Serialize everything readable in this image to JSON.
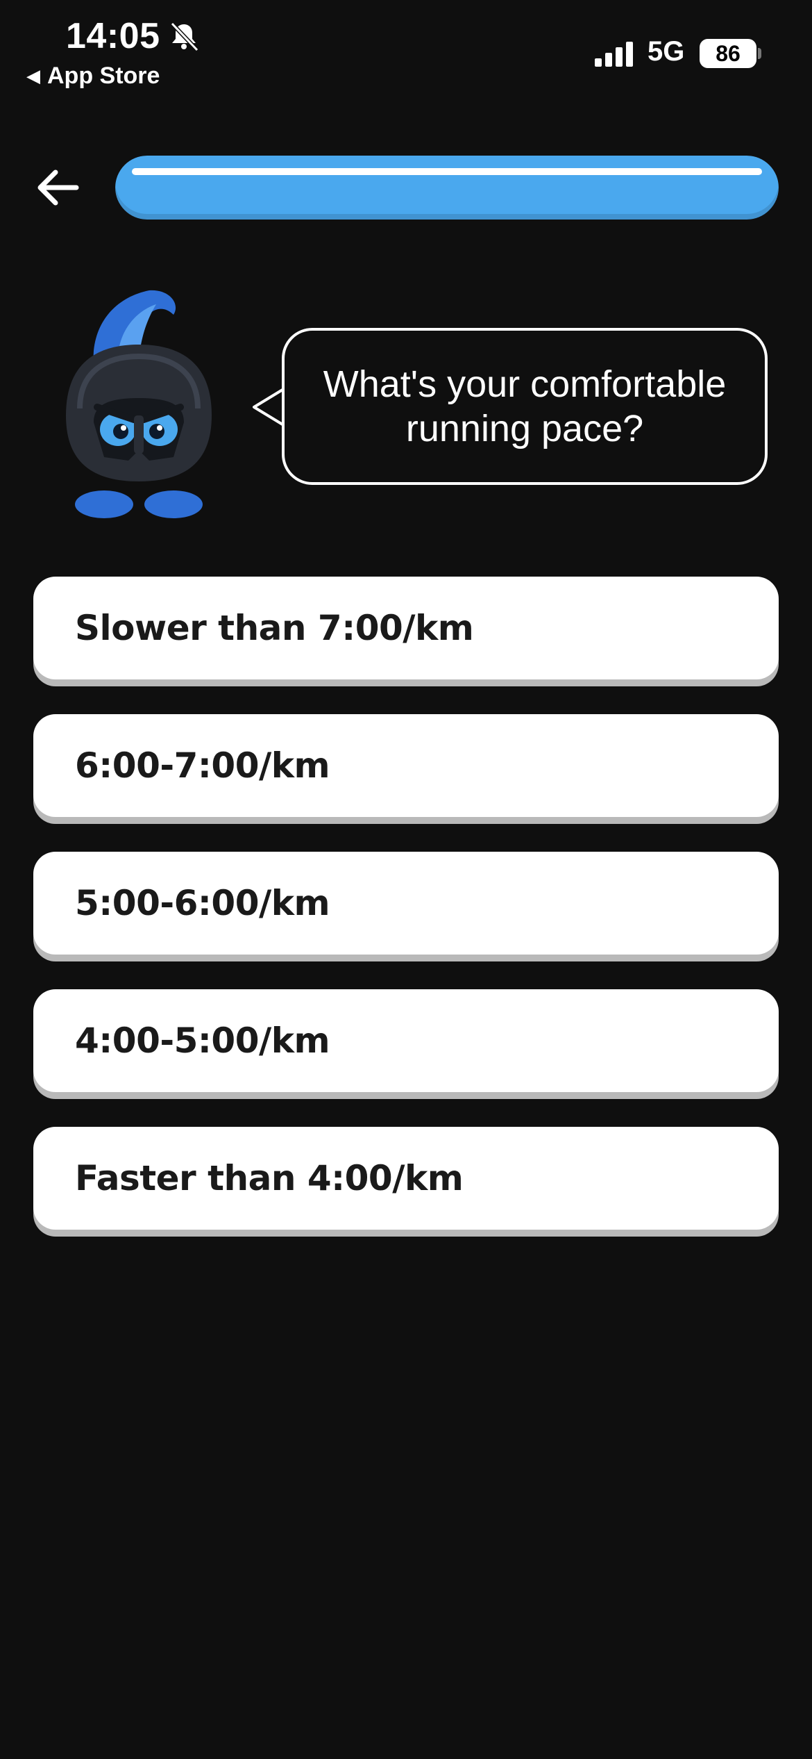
{
  "status_bar": {
    "time": "14:05",
    "back_app": "App Store",
    "network": "5G",
    "battery": "86"
  },
  "header": {
    "progress_fraction": 1.0
  },
  "prompt": {
    "question": "What's your comfortable running pace?"
  },
  "options": [
    {
      "label": "Slower than 7:00/km"
    },
    {
      "label": "6:00-7:00/km"
    },
    {
      "label": "5:00-6:00/km"
    },
    {
      "label": "4:00-5:00/km"
    },
    {
      "label": "Faster than 4:00/km"
    }
  ],
  "colors": {
    "background": "#0f0f0f",
    "accent": "#4aa8ee",
    "option_bg": "#ffffff",
    "option_text": "#1a1a1a"
  },
  "icons": {
    "back": "arrow-left-icon",
    "mute": "bell-slash-icon",
    "signal": "cellular-signal-icon",
    "mascot": "spartan-helmet-mascot"
  }
}
